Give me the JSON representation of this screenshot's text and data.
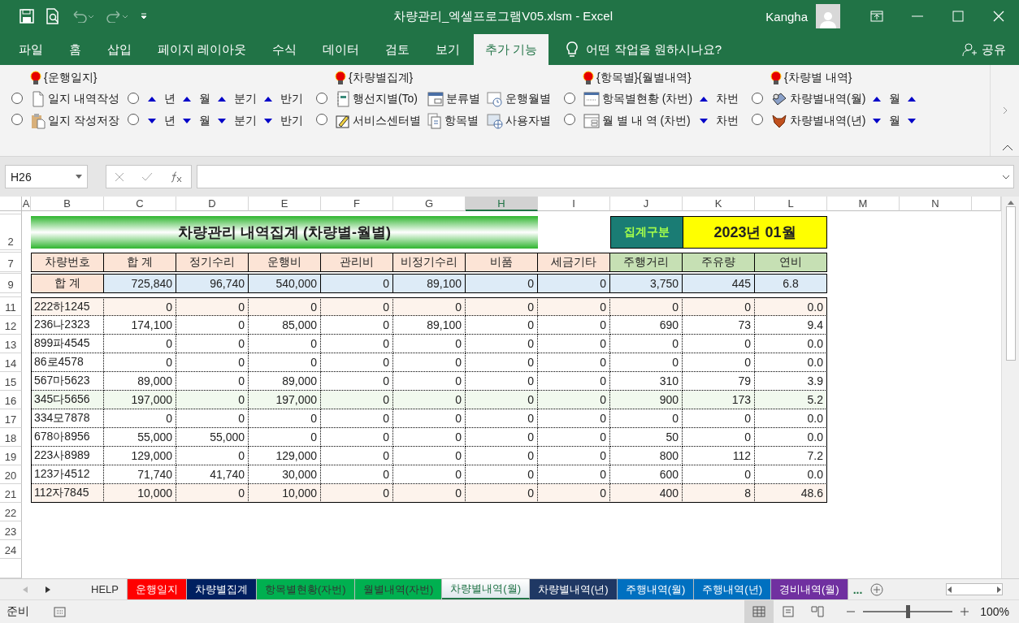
{
  "window": {
    "title": "차량관리_엑셀프로그램V05.xlsm  -  Excel",
    "user": "Kangha"
  },
  "ribbon_tabs": [
    {
      "label": "파일",
      "selected": false
    },
    {
      "label": "홈",
      "selected": false
    },
    {
      "label": "삽입",
      "selected": false
    },
    {
      "label": "페이지 레이아웃",
      "selected": false
    },
    {
      "label": "수식",
      "selected": false
    },
    {
      "label": "데이터",
      "selected": false
    },
    {
      "label": "검토",
      "selected": false
    },
    {
      "label": "보기",
      "selected": false
    },
    {
      "label": "추가 기능",
      "selected": true
    }
  ],
  "tell_me": "어떤 작업을 원하시나요?",
  "share": "공유",
  "ribbon_groups": [
    {
      "header": "{운행일지}",
      "columns": [
        [
          {
            "kind": "radio",
            "selected": false
          },
          {
            "kind": "radio",
            "selected": false
          }
        ],
        [
          {
            "kind": "button",
            "label": "일지 내역작성"
          },
          {
            "kind": "button",
            "label": "일지 작성저장"
          }
        ],
        [
          {
            "kind": "radio",
            "selected": false
          },
          {
            "kind": "radio",
            "selected": false
          }
        ],
        [
          {
            "kind": "up",
            "label": "년"
          },
          {
            "kind": "down",
            "label": "년"
          }
        ],
        [
          {
            "kind": "up",
            "label": "월"
          },
          {
            "kind": "down",
            "label": "월"
          }
        ],
        [
          {
            "kind": "up",
            "label": "분기"
          },
          {
            "kind": "down",
            "label": "분기"
          }
        ],
        [
          {
            "kind": "up",
            "label": "반기"
          },
          {
            "kind": "down",
            "label": "반기"
          }
        ]
      ]
    },
    {
      "header": "{차량별집계}",
      "columns": [
        [
          {
            "kind": "radio",
            "selected": false
          },
          {
            "kind": "radio",
            "selected": false
          }
        ],
        [
          {
            "kind": "button",
            "label": "행선지별(To)"
          },
          {
            "kind": "button",
            "label": "서비스센터별"
          }
        ],
        [
          {
            "kind": "button",
            "label": "분류별"
          },
          {
            "kind": "button",
            "label": "항목별"
          }
        ],
        [
          {
            "kind": "button",
            "label": "운행월별"
          },
          {
            "kind": "button",
            "label": "사용자별"
          }
        ]
      ]
    },
    {
      "header": "{항목별}{월별내역}",
      "columns": [
        [
          {
            "kind": "radio",
            "selected": false
          },
          {
            "kind": "radio",
            "selected": false
          }
        ],
        [
          {
            "kind": "button",
            "label": "항목별현황 (차번)"
          },
          {
            "kind": "button",
            "label": "월 별 내 역 (차번)"
          }
        ],
        [
          {
            "kind": "up",
            "label": "차번"
          },
          {
            "kind": "down",
            "label": "차번"
          }
        ]
      ]
    },
    {
      "header": "{차량별 내역}",
      "columns": [
        [
          {
            "kind": "radio",
            "selected": false
          },
          {
            "kind": "radio",
            "selected": false
          }
        ],
        [
          {
            "kind": "button",
            "label": "차량별내역(월)"
          },
          {
            "kind": "button",
            "label": "차량별내역(년)"
          }
        ],
        [
          {
            "kind": "up",
            "label": "월"
          },
          {
            "kind": "down",
            "label": "월"
          }
        ],
        [
          {
            "kind": "up"
          },
          {
            "kind": "down"
          }
        ]
      ]
    }
  ],
  "name_box": "H26",
  "columns": [
    {
      "label": "A",
      "selected": false
    },
    {
      "label": "B",
      "selected": false
    },
    {
      "label": "C",
      "selected": false
    },
    {
      "label": "D",
      "selected": false
    },
    {
      "label": "E",
      "selected": false
    },
    {
      "label": "F",
      "selected": false
    },
    {
      "label": "G",
      "selected": false
    },
    {
      "label": "H",
      "selected": true
    },
    {
      "label": "I",
      "selected": false
    },
    {
      "label": "J",
      "selected": false
    },
    {
      "label": "K",
      "selected": false
    },
    {
      "label": "L",
      "selected": false
    },
    {
      "label": "M",
      "selected": false
    },
    {
      "label": "N",
      "selected": false
    }
  ],
  "sheet": {
    "title": "차량관리 내역집계 (차량별-월별)",
    "title_row": "2",
    "period_label": "집계구분",
    "period": "2023년 01월",
    "header_row": "7",
    "headers": [
      {
        "label": "차량번호",
        "kind": "cost"
      },
      {
        "label": "합  계",
        "kind": "cost"
      },
      {
        "label": "정기수리",
        "kind": "cost"
      },
      {
        "label": "운행비",
        "kind": "cost"
      },
      {
        "label": "관리비",
        "kind": "cost"
      },
      {
        "label": "비정기수리",
        "kind": "cost"
      },
      {
        "label": "비품",
        "kind": "cost"
      },
      {
        "label": "세금기타",
        "kind": "cost"
      },
      {
        "label": "주행거리",
        "kind": "fuel"
      },
      {
        "label": "주유량",
        "kind": "fuel"
      },
      {
        "label": "연비",
        "kind": "fuel"
      }
    ],
    "total_row": "9",
    "totals": [
      "합  계",
      "725,840",
      "96,740",
      "540,000",
      "0",
      "89,100",
      "0",
      "0",
      "3,750",
      "445",
      "6.8"
    ],
    "rows": [
      {
        "number": "11",
        "color": "#fdf3ec",
        "cells": [
          "222하1245",
          "0",
          "0",
          "0",
          "0",
          "0",
          "0",
          "0",
          "0",
          "0",
          "0.0"
        ]
      },
      {
        "number": "12",
        "cells": [
          "236나2323",
          "174,100",
          "0",
          "85,000",
          "0",
          "89,100",
          "0",
          "0",
          "690",
          "73",
          "9.4"
        ]
      },
      {
        "number": "13",
        "cells": [
          "899파4545",
          "0",
          "0",
          "0",
          "0",
          "0",
          "0",
          "0",
          "0",
          "0",
          "0.0"
        ]
      },
      {
        "number": "14",
        "cells": [
          "86로4578",
          "0",
          "0",
          "0",
          "0",
          "0",
          "0",
          "0",
          "0",
          "0",
          "0.0"
        ]
      },
      {
        "number": "15",
        "cells": [
          "567마5623",
          "89,000",
          "0",
          "89,000",
          "0",
          "0",
          "0",
          "0",
          "310",
          "79",
          "3.9"
        ]
      },
      {
        "number": "16",
        "color": "#f1f9ee",
        "cells": [
          "345다5656",
          "197,000",
          "0",
          "197,000",
          "0",
          "0",
          "0",
          "0",
          "900",
          "173",
          "5.2"
        ]
      },
      {
        "number": "17",
        "cells": [
          "334모7878",
          "0",
          "0",
          "0",
          "0",
          "0",
          "0",
          "0",
          "0",
          "0",
          "0.0"
        ]
      },
      {
        "number": "18",
        "cells": [
          "678아8956",
          "55,000",
          "55,000",
          "0",
          "0",
          "0",
          "0",
          "0",
          "50",
          "0",
          "0.0"
        ]
      },
      {
        "number": "19",
        "cells": [
          "223사8989",
          "129,000",
          "0",
          "129,000",
          "0",
          "0",
          "0",
          "0",
          "800",
          "112",
          "7.2"
        ]
      },
      {
        "number": "20",
        "cells": [
          "123가4512",
          "71,740",
          "41,740",
          "30,000",
          "0",
          "0",
          "0",
          "0",
          "600",
          "0",
          "0.0"
        ]
      },
      {
        "number": "21",
        "color": "#fdf3ec",
        "cells": [
          "112자7845",
          "10,000",
          "0",
          "10,000",
          "0",
          "0",
          "0",
          "0",
          "400",
          "8",
          "48.6"
        ]
      }
    ],
    "empty_rows": [
      "22",
      "23",
      "24"
    ]
  },
  "sheet_tabs": [
    {
      "label": "HELP",
      "selected": false
    },
    {
      "label": "운행일지",
      "color": "#ff0000",
      "selected": false
    },
    {
      "label": "차량별집계",
      "color": "#002060",
      "selected": false
    },
    {
      "label": "항목별현황(자번)",
      "color": "#00b050",
      "selected": false
    },
    {
      "label": "월별내역(자번)",
      "color": "#00b050",
      "selected": false
    },
    {
      "label": "차량별내역(월)",
      "selected": true
    },
    {
      "label": "차량별내역(년)",
      "color": "#1f3864",
      "selected": false
    },
    {
      "label": "주행내역(월)",
      "color": "#0070c0",
      "selected": false
    },
    {
      "label": "주행내역(년)",
      "color": "#0070c0",
      "selected": false
    },
    {
      "label": "경비내역(월)",
      "color": "#7030a0",
      "selected": false
    }
  ],
  "more_tabs": "...",
  "status": {
    "text": "준비",
    "zoom": "100%",
    "level": 0.5,
    "views": [
      {
        "kind": "normal",
        "selected": true
      },
      {
        "kind": "layout",
        "selected": false
      },
      {
        "kind": "break",
        "selected": false
      }
    ]
  }
}
